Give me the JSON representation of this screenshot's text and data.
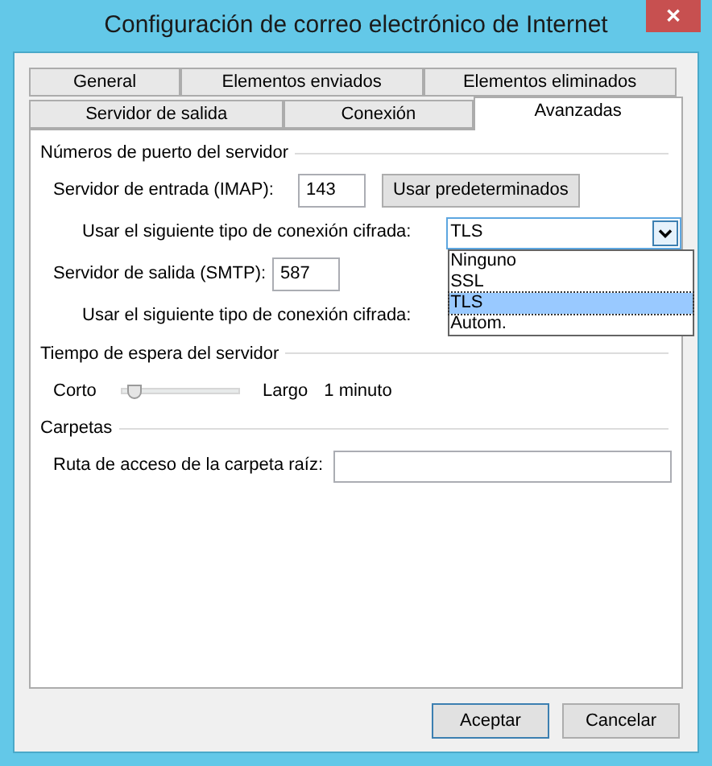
{
  "window": {
    "title": "Configuración de correo electrónico de Internet",
    "close": "✕"
  },
  "tab_rows": [
    [
      {
        "label": "General",
        "selected": false
      },
      {
        "label": "Elementos enviados",
        "selected": false
      },
      {
        "label": "Elementos eliminados",
        "selected": false
      }
    ],
    [
      {
        "label": "Servidor de salida",
        "selected": false
      },
      {
        "label": "Conexión",
        "selected": false
      },
      {
        "label": "Avanzadas",
        "selected": true
      }
    ]
  ],
  "ports": {
    "heading": "Números de puerto del servidor",
    "incoming_label": "Servidor de entrada (IMAP):",
    "incoming_value": "143",
    "defaults_button": "Usar predeterminados",
    "encryption_label_1": "Usar el siguiente tipo de conexión cifrada:",
    "encryption_value": "TLS",
    "encryption_options": [
      {
        "label": "Ninguno",
        "selected": false
      },
      {
        "label": "SSL",
        "selected": false
      },
      {
        "label": "TLS",
        "selected": true
      },
      {
        "label": "Autom.",
        "selected": false
      }
    ],
    "outgoing_label": "Servidor de salida (SMTP):",
    "outgoing_value": "587",
    "encryption_label_2": "Usar el siguiente tipo de conexión cifrada:"
  },
  "timeout": {
    "heading": "Tiempo de espera del servidor",
    "min_label": "Corto",
    "level": 0.1,
    "max_label": "Largo",
    "reading": "1 minuto"
  },
  "folders": {
    "heading": "Carpetas",
    "root_label": "Ruta de acceso de la carpeta raíz:"
  },
  "buttons": [
    {
      "label": "Aceptar",
      "default": true
    },
    {
      "label": "Cancelar",
      "default": false
    }
  ]
}
